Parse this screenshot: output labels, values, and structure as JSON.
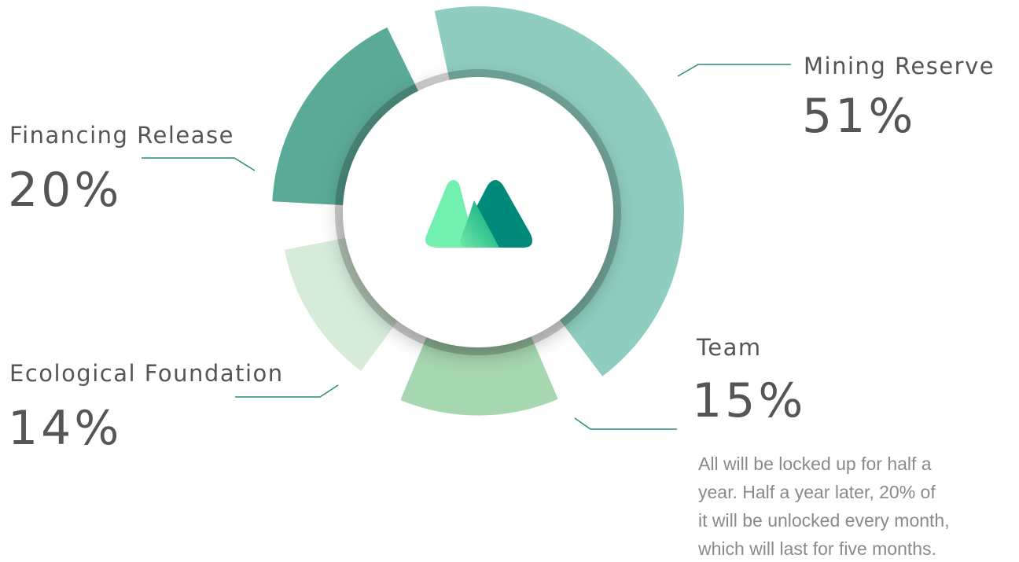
{
  "chart_data": {
    "type": "pie",
    "variant": "donut",
    "start_angle_deg": 180,
    "direction": "clockwise",
    "slices": [
      {
        "key": "financing",
        "label": "Financing Release",
        "value": 20,
        "value_text": "20%",
        "color": "#5ba997"
      },
      {
        "key": "mining",
        "label": "Mining Reserve",
        "value": 51,
        "value_text": "51%",
        "color": "#8ecdbf"
      },
      {
        "key": "team",
        "label": "Team",
        "value": 15,
        "value_text": "15%",
        "color": "#a6d7b0"
      },
      {
        "key": "eco",
        "label": "Ecological Foundation",
        "value": 14,
        "value_text": "14%",
        "color": "#d6ecd9"
      }
    ],
    "team_note": [
      "All will be locked up for half a",
      "year. Half a year later, 20% of",
      "it will be unlocked every month,",
      "which will last for five months."
    ]
  },
  "colors": {
    "leader_line": "#2a8c7e",
    "text": "#555555",
    "note_text": "#8a8a8a",
    "logo_light": "#72f0b0",
    "logo_dark": "#008a7a"
  },
  "logo": {
    "icon": "brand-mountain-logo-icon"
  }
}
